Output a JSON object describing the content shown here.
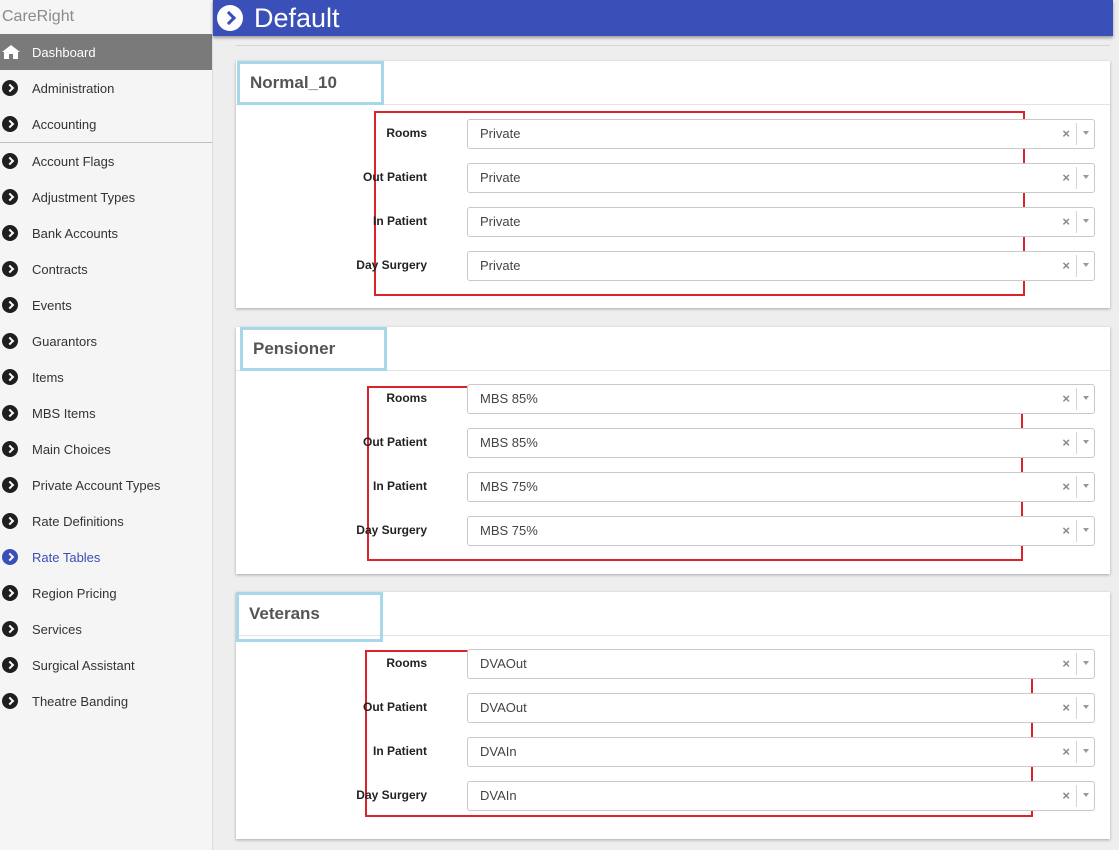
{
  "app": {
    "brand": "CareRight"
  },
  "header": {
    "title": "Default"
  },
  "sidebar": {
    "items": [
      {
        "label": "Dashboard",
        "active": true
      },
      {
        "label": "Administration"
      },
      {
        "label": "Accounting"
      },
      {
        "label": "Account Flags"
      },
      {
        "label": "Adjustment Types"
      },
      {
        "label": "Bank Accounts"
      },
      {
        "label": "Contracts"
      },
      {
        "label": "Events"
      },
      {
        "label": "Guarantors"
      },
      {
        "label": "Items"
      },
      {
        "label": "MBS Items"
      },
      {
        "label": "Main Choices"
      },
      {
        "label": "Private Account Types"
      },
      {
        "label": "Rate Definitions"
      },
      {
        "label": "Rate Tables",
        "current": true
      },
      {
        "label": "Region Pricing"
      },
      {
        "label": "Services"
      },
      {
        "label": "Surgical Assistant"
      },
      {
        "label": "Theatre Banding"
      }
    ]
  },
  "panels": [
    {
      "title": "Normal_10",
      "rows": [
        {
          "label": "Rooms",
          "value": "Private"
        },
        {
          "label": "Out Patient",
          "value": "Private"
        },
        {
          "label": "In Patient",
          "value": "Private"
        },
        {
          "label": "Day Surgery",
          "value": "Private"
        }
      ]
    },
    {
      "title": "Pensioner",
      "rows": [
        {
          "label": "Rooms",
          "value": "MBS 85%"
        },
        {
          "label": "Out Patient",
          "value": "MBS 85%"
        },
        {
          "label": "In Patient",
          "value": "MBS 75%"
        },
        {
          "label": "Day Surgery",
          "value": "MBS 75%"
        }
      ]
    },
    {
      "title": "Veterans",
      "rows": [
        {
          "label": "Rooms",
          "value": "DVAOut"
        },
        {
          "label": "Out Patient",
          "value": "DVAOut"
        },
        {
          "label": "In Patient",
          "value": "DVAIn"
        },
        {
          "label": "Day Surgery",
          "value": "DVAIn"
        }
      ]
    }
  ],
  "icons": {
    "clear": "×",
    "sidebar_item": "chevron-circle-right-icon",
    "dashboard": "home-icon"
  },
  "colors": {
    "primary": "#3a4fb8",
    "highlight_red": "#d9232d",
    "highlight_blue": "#a7d8ea"
  }
}
